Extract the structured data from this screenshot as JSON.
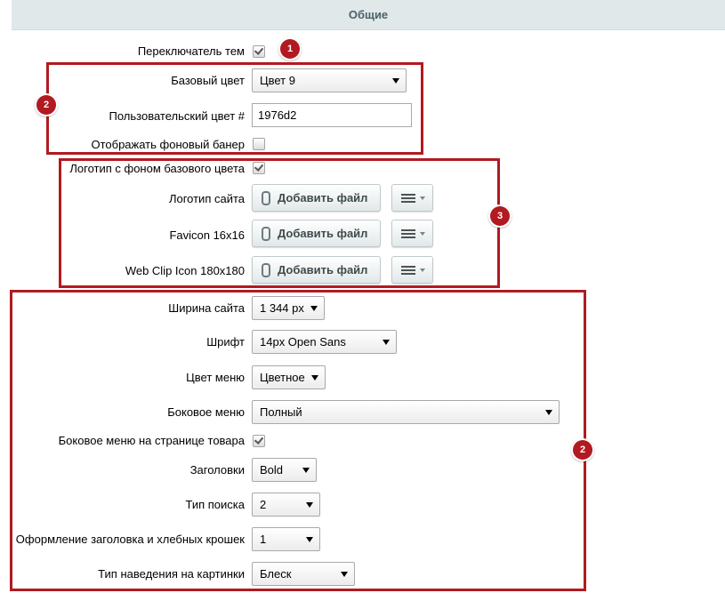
{
  "header": {
    "title": "Общие"
  },
  "rows": {
    "theme_switcher": {
      "label": "Переключатель тем",
      "checked": true
    },
    "base_color": {
      "label": "Базовый цвет",
      "value": "Цвет 9"
    },
    "custom_color": {
      "label": "Пользовательский цвет #",
      "value": "1976d2"
    },
    "bg_banner": {
      "label": "Отображать фоновый банер",
      "checked": false
    },
    "logo_bg": {
      "label": "Логотип с фоном базового цвета",
      "checked": true
    },
    "site_logo": {
      "label": "Логотип сайта",
      "button": "Добавить файл"
    },
    "favicon": {
      "label": "Favicon 16x16",
      "button": "Добавить файл"
    },
    "webclip": {
      "label": "Web Clip Icon 180x180",
      "button": "Добавить файл"
    },
    "site_width": {
      "label": "Ширина сайта",
      "value": "1 344 px"
    },
    "font": {
      "label": "Шрифт",
      "value": "14px Open Sans"
    },
    "menu_color": {
      "label": "Цвет меню",
      "value": "Цветное"
    },
    "side_menu": {
      "label": "Боковое меню",
      "value": "Полный"
    },
    "side_menu_product": {
      "label": "Боковое меню на странице товара",
      "checked": true
    },
    "headings": {
      "label": "Заголовки",
      "value": "Bold"
    },
    "search_type": {
      "label": "Тип поиска",
      "value": "2"
    },
    "breadcrumbs": {
      "label": "Оформление заголовка и хлебных крошек",
      "value": "1"
    },
    "hover_type": {
      "label": "Тип наведения на картинки",
      "value": "Блеск"
    }
  },
  "annotations": {
    "badge1": "1",
    "badge2": "2",
    "badge3": "3",
    "badge4": "2"
  },
  "colors": {
    "annotation": "#b11a20",
    "header_bg": "#e0e8ea",
    "header_text": "#4b6267"
  },
  "icons": {
    "attach": "paperclip-icon",
    "menu": "hamburger-menu-icon"
  }
}
